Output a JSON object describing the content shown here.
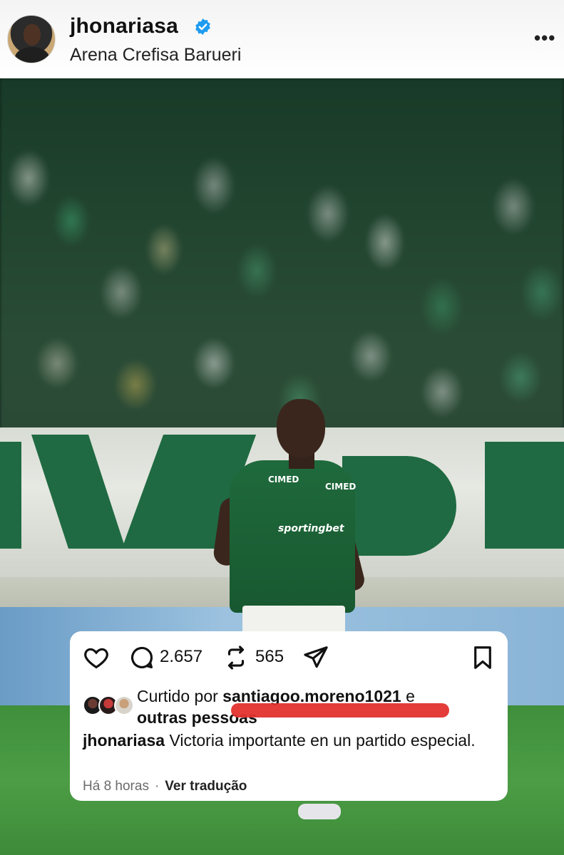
{
  "post": {
    "username": "jhonariasa",
    "location": "Arena Crefisa Barueri",
    "more_label": "•••",
    "verified_icon": "verified-badge-icon"
  },
  "photo": {
    "jersey_sponsor_1": "CIMED",
    "jersey_sponsor_2": "CIMED",
    "jersey_main_sponsor": "sportingbet"
  },
  "actions": {
    "comment_count": "2.657",
    "repost_count": "565",
    "icons": [
      "heart-icon",
      "comment-icon",
      "repost-icon",
      "share-icon",
      "bookmark-icon"
    ]
  },
  "likes": {
    "prefix": "Curtido por",
    "liked_by_user": "santiagoo.moreno1021",
    "conjunction": "e",
    "others": "outras pessoas"
  },
  "caption": {
    "user": "jhonariasa",
    "text": "Victoria importante en un partido especial."
  },
  "meta": {
    "time": "Há 8 horas",
    "separator": "·",
    "translate_label": "Ver tradução"
  },
  "colors": {
    "verified_blue": "#1d9bf0",
    "redaction_red": "#e1322e",
    "palmeiras_green": "#1f6a3c"
  }
}
